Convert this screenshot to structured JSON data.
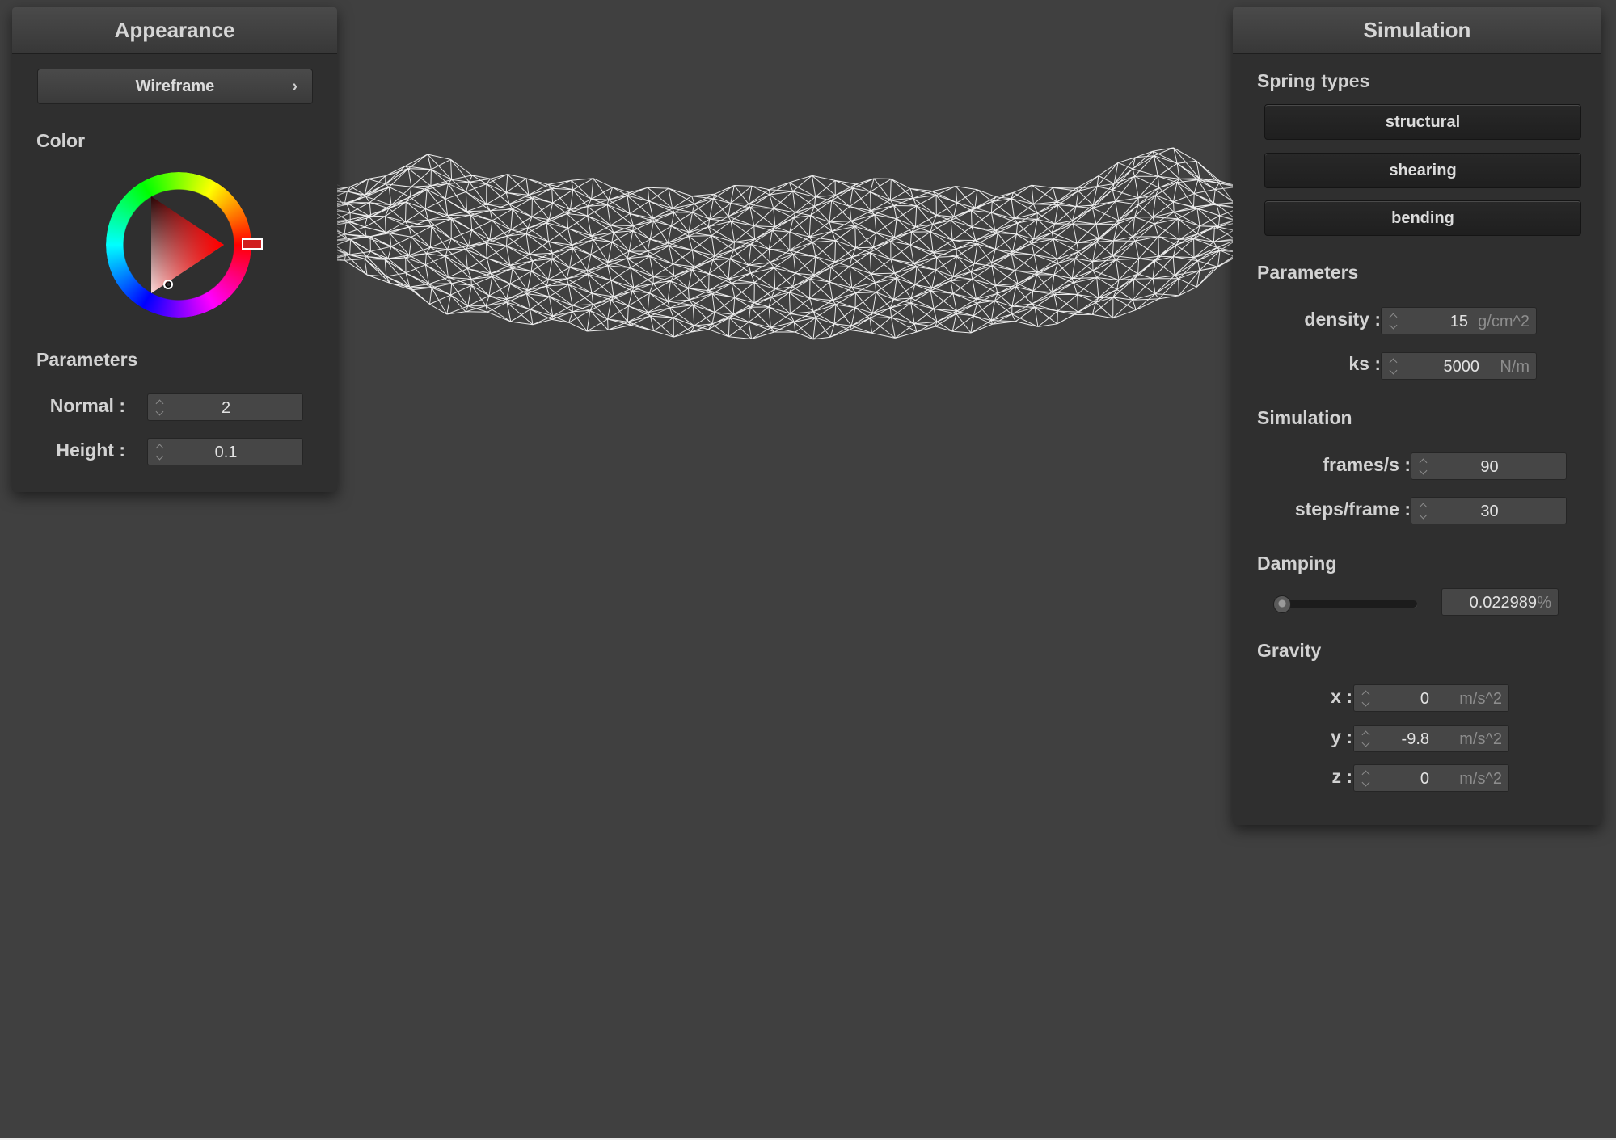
{
  "colors": {
    "background": "#404040",
    "panel": "#2f2f2f",
    "mesh": "#ffffff",
    "selected_color": "#ff0000"
  },
  "appearance": {
    "title": "Appearance",
    "shader_button": {
      "label": "Wireframe",
      "icon": "chevron-right-icon",
      "glyph": "›"
    },
    "color_section": "Color",
    "color_wheel": {
      "selected_hex": "#ff0000"
    },
    "parameters_section": "Parameters",
    "normal": {
      "label": "Normal :",
      "value": "2"
    },
    "height": {
      "label": "Height :",
      "value": "0.1"
    }
  },
  "simulation": {
    "title": "Simulation",
    "spring_types_section": "Spring types",
    "spring_buttons": [
      "structural",
      "shearing",
      "bending"
    ],
    "parameters_section": "Parameters",
    "density": {
      "label": "density :",
      "value": "15",
      "unit": "g/cm^2"
    },
    "ks": {
      "label": "ks :",
      "value": "5000",
      "unit": "N/m"
    },
    "simulation_section": "Simulation",
    "frames_per_second": {
      "label": "frames/s :",
      "value": "90"
    },
    "steps_per_frame": {
      "label": "steps/frame :",
      "value": "30"
    },
    "damping_section": "Damping",
    "damping": {
      "value": "0.022989",
      "unit": "%",
      "slider_fraction": 0.0002
    },
    "gravity_section": "Gravity",
    "gravity": [
      {
        "label": "x :",
        "value": "0",
        "unit": "m/s^2"
      },
      {
        "label": "y :",
        "value": "-9.8",
        "unit": "m/s^2"
      },
      {
        "label": "z :",
        "value": "0",
        "unit": "m/s^2"
      }
    ]
  }
}
